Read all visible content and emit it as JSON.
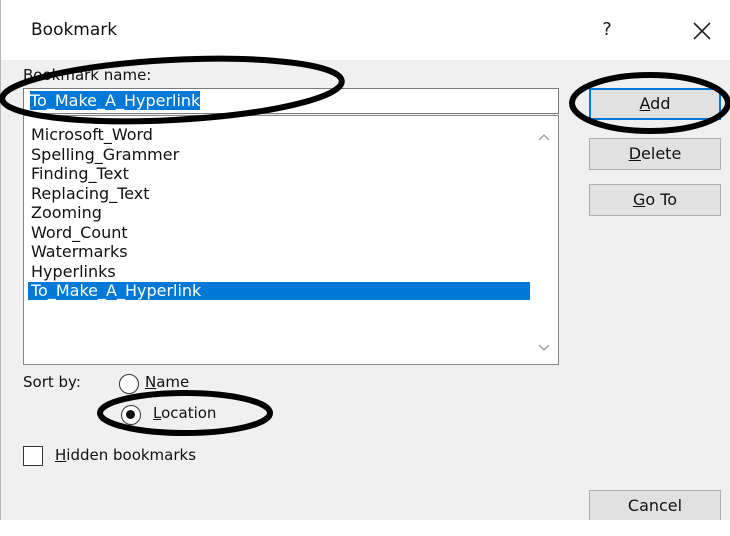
{
  "window": {
    "title": "Bookmark",
    "help_label": "?",
    "close_icon": "close-icon"
  },
  "bookmark_name": {
    "label_mnemonic": "B",
    "label_rest": "ookmark name:",
    "value": "To_Make_A_Hyperlink"
  },
  "bookmarks": {
    "items": [
      "Microsoft_Word",
      "Spelling_Grammer",
      "Finding_Text",
      "Replacing_Text",
      "Zooming",
      "Word_Count",
      "Watermarks",
      "Hyperlinks",
      "To_Make_A_Hyperlink"
    ],
    "selected": "To_Make_A_Hyperlink"
  },
  "buttons": {
    "add": {
      "mnemonic": "A",
      "rest": "dd"
    },
    "delete": {
      "mnemonic": "D",
      "rest": "elete"
    },
    "goto": {
      "mnemonic": "G",
      "rest": "o To"
    },
    "cancel": "Cancel"
  },
  "sort": {
    "label": "Sort by:",
    "name_mnemonic": "N",
    "name_rest": "ame",
    "location_mnemonic": "L",
    "location_rest": "ocation",
    "selected": "Location"
  },
  "hidden": {
    "mnemonic": "H",
    "rest": "idden bookmarks",
    "checked": false
  },
  "colors": {
    "selection": "#0078d7",
    "annotation": "#000000"
  }
}
